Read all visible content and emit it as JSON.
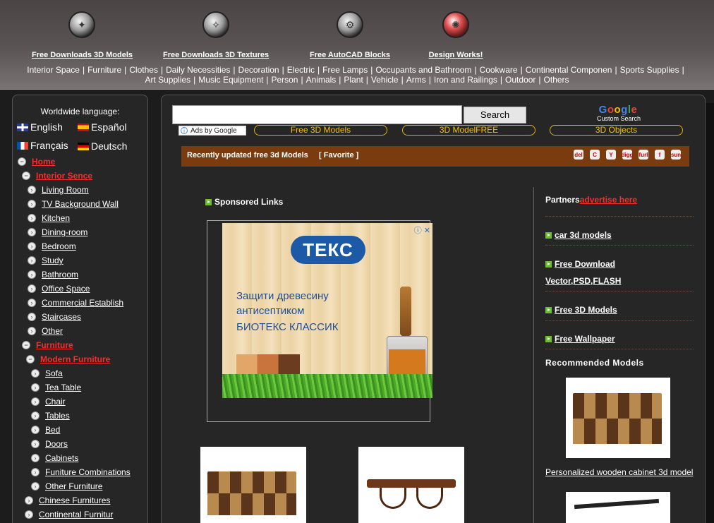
{
  "header": {
    "top_links": [
      {
        "label": "Free Downloads 3D Models",
        "icon": "model-icon"
      },
      {
        "label": "Free Downloads 3D Textures",
        "icon": "texture-icon"
      },
      {
        "label": "Free AutoCAD Blocks",
        "icon": "gear-icon"
      },
      {
        "label": "Design Works!",
        "icon": "design-icon"
      }
    ],
    "categories_row1": [
      "Interior Space",
      "Furniture",
      "Clothes",
      "Daily Necessities",
      "Decoration",
      "Electric",
      "Free Lamps",
      "Occupants and Bathroom",
      "Cookware",
      "Continental Componen",
      "Sports Supplies"
    ],
    "categories_row2": [
      "Art Supplies",
      "Music Equipment",
      "Person",
      "Animals",
      "Plant",
      "Vehicle",
      "Arms",
      "Iron and Railings",
      "Outdoor",
      "Others"
    ],
    "separator": "|"
  },
  "sidebar": {
    "language_title": "Worldwide language:",
    "languages": [
      "English",
      "Español",
      "Français",
      "Deutsch"
    ],
    "tree": [
      {
        "label": "Home",
        "style": "red"
      },
      {
        "label": "Interior Sence",
        "style": "red"
      },
      {
        "label": "Living Room"
      },
      {
        "label": "TV Background Wall"
      },
      {
        "label": "Kitchen"
      },
      {
        "label": "Dining-room"
      },
      {
        "label": "Bedroom"
      },
      {
        "label": "Study"
      },
      {
        "label": "Bathroom"
      },
      {
        "label": "Office Space"
      },
      {
        "label": "Commercial Establish"
      },
      {
        "label": "Staircases"
      },
      {
        "label": "Other"
      },
      {
        "label": "Furniture",
        "style": "red"
      },
      {
        "label": "Modern Furniture",
        "style": "red"
      },
      {
        "label": "Sofa"
      },
      {
        "label": "Tea Table"
      },
      {
        "label": "Chair"
      },
      {
        "label": "Tables"
      },
      {
        "label": "Bed"
      },
      {
        "label": "Doors"
      },
      {
        "label": "Cabinets"
      },
      {
        "label": "Funiture Combinations"
      },
      {
        "label": "Other Furniture"
      },
      {
        "label": "Chinese Furnitures"
      },
      {
        "label": "Continental Furnitur"
      }
    ]
  },
  "search": {
    "value": "",
    "button_label": "Search",
    "google_logo": "Google",
    "custom_search": "Custom Search",
    "ads_by": "Ads by Google"
  },
  "pills": [
    "Free 3D Models",
    "3D ModelFREE",
    "3D Objects"
  ],
  "bar": {
    "title": "Recently updated free 3d Models",
    "favorite": "[ Favorite ]",
    "share_icons": [
      "del",
      "C",
      "Y",
      "digg",
      "furl",
      "f",
      "sun"
    ]
  },
  "sponsored": "Sponsored Links",
  "ad": {
    "logo": "ТЕКС",
    "line1": "Защити древесину",
    "line2": "антисептиком",
    "line3": "БИОТЕКС КЛАССИК"
  },
  "right": {
    "partners": "Partners",
    "advertise": "advertise here",
    "links": [
      "car 3d models",
      "Free Download",
      "Vector,PSD,FLASH",
      "Free 3D Models",
      "Free Wallpaper"
    ],
    "recommended": "Recommended Models",
    "rec_caption": "Personalized wooden cabinet 3d model"
  },
  "colors": {
    "accent_red": "#ff2a2a",
    "bar_brown": "#7a3c0e",
    "pill_gold": "#f2c200"
  }
}
